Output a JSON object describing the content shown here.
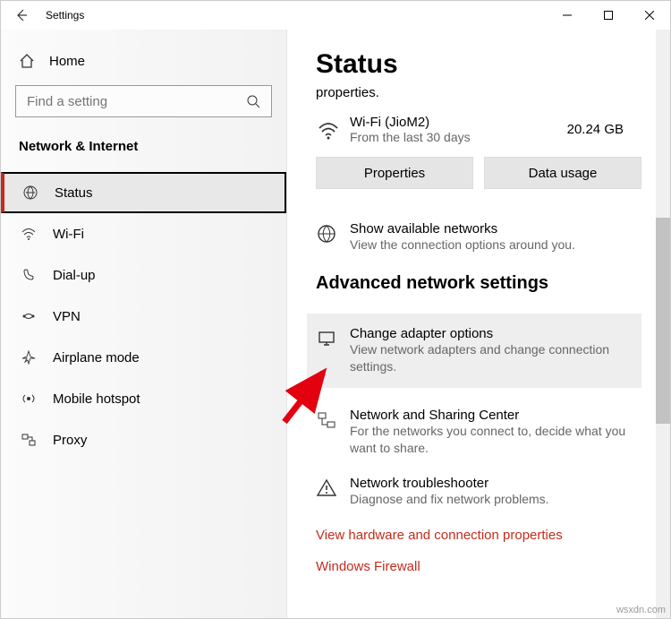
{
  "titlebar": {
    "title": "Settings"
  },
  "sidebar": {
    "home": "Home",
    "search_placeholder": "Find a setting",
    "category": "Network & Internet",
    "items": [
      {
        "label": "Status"
      },
      {
        "label": "Wi-Fi"
      },
      {
        "label": "Dial-up"
      },
      {
        "label": "VPN"
      },
      {
        "label": "Airplane mode"
      },
      {
        "label": "Mobile hotspot"
      },
      {
        "label": "Proxy"
      }
    ]
  },
  "content": {
    "heading": "Status",
    "sub": "properties.",
    "wifi": {
      "name": "Wi-Fi (JioM2)",
      "meta": "From the last 30 days",
      "gb": "20.24 GB"
    },
    "buttons": {
      "properties": "Properties",
      "datausage": "Data usage"
    },
    "available": {
      "title": "Show available networks",
      "desc": "View the connection options around you."
    },
    "advanced_heading": "Advanced network settings",
    "adapter": {
      "title": "Change adapter options",
      "desc": "View network adapters and change connection settings."
    },
    "sharing": {
      "title": "Network and Sharing Center",
      "desc": "For the networks you connect to, decide what you want to share."
    },
    "trouble": {
      "title": "Network troubleshooter",
      "desc": "Diagnose and fix network problems."
    },
    "links": {
      "hw": "View hardware and connection properties",
      "fw": "Windows Firewall"
    }
  },
  "watermark": "wsxdn.com"
}
